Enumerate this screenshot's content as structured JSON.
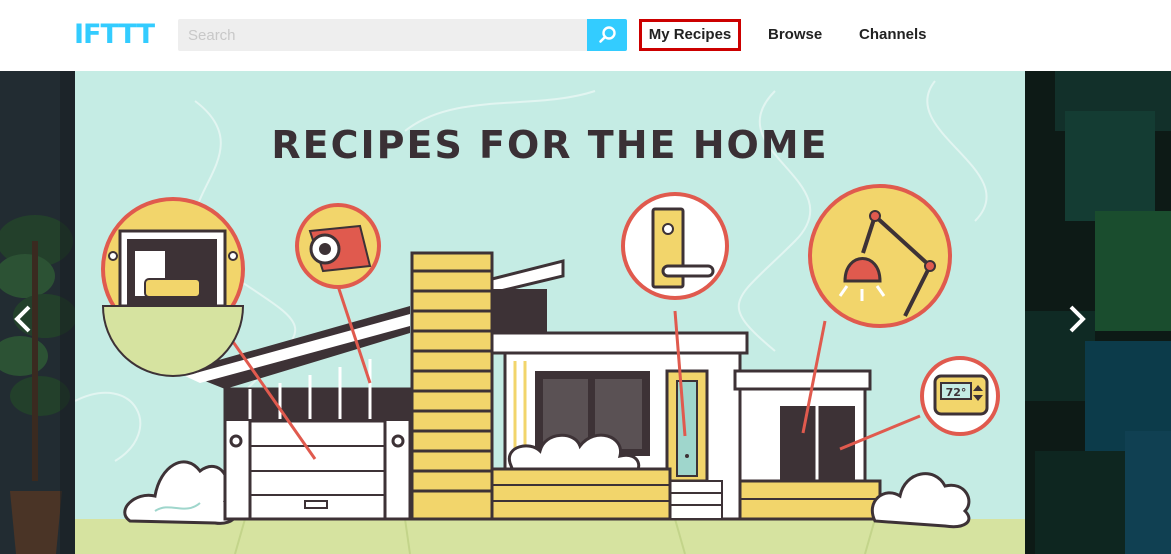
{
  "header": {
    "logo": "IFTTT",
    "search": {
      "placeholder": "Search",
      "value": ""
    },
    "search_icon": "magnifier-icon",
    "nav": [
      {
        "label": "My Recipes",
        "highlighted": true
      },
      {
        "label": "Browse"
      },
      {
        "label": "Channels"
      }
    ]
  },
  "carousel": {
    "slide_title": "RECIPES FOR THE HOME",
    "thermostat_reading": "72°",
    "prev_icon": "chevron-left-icon",
    "next_icon": "chevron-right-icon"
  },
  "colors": {
    "brand": "#33ccff",
    "highlight_border": "#cc0000",
    "slide_background": "#c5ece4",
    "house_dark": "#3d3236",
    "house_yellow": "#f2d56b",
    "callout_red": "#e05a4e",
    "lawn": "#d6e3a0"
  }
}
